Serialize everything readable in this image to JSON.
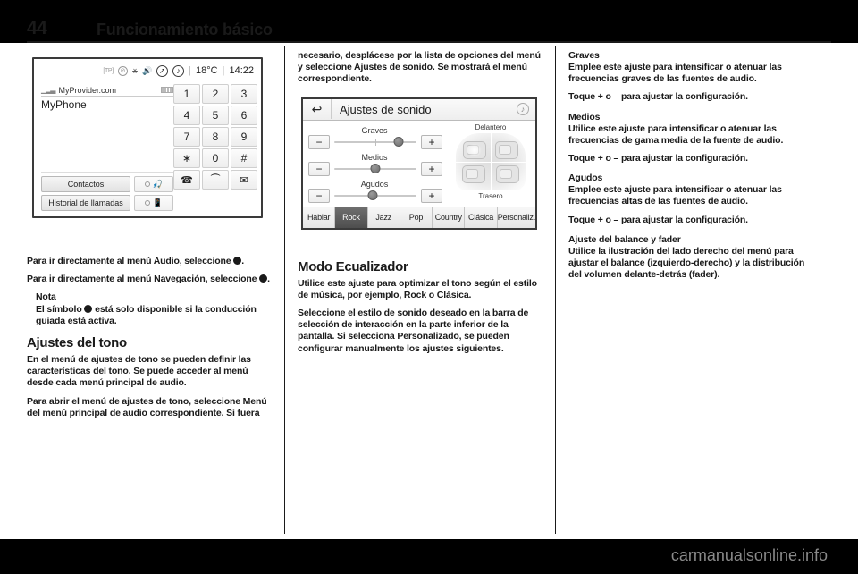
{
  "page": {
    "folio": "44",
    "chapter_title": "Funcionamiento básico",
    "footer_watermark": "carmanualsonline.info"
  },
  "figure_phone": {
    "status_bar": {
      "tp_label": "[TP]",
      "icons": [
        "tp-label",
        "no-entry-icon",
        "bluetooth-icon",
        "speaker-icon",
        "navigation-compass-icon",
        "audio-note-icon"
      ],
      "temperature": "18°C",
      "clock": "14:22"
    },
    "provider": "MyProvider.com",
    "device_name": "MyPhone",
    "buttons": {
      "contacts": "Contactos",
      "call_history": "Historial de llamadas"
    },
    "toggles": [
      "mute-microphone-icon",
      "phone-speaker-icon"
    ],
    "keypad": [
      "1",
      "2",
      "3",
      "4",
      "5",
      "6",
      "7",
      "8",
      "9",
      "∗",
      "0",
      "#"
    ],
    "keypad_star_secondary": "+",
    "action_keys": [
      "call-icon",
      "hang-up-icon",
      "voicemail-icon"
    ]
  },
  "figure_sound": {
    "back_icon": "back-arrow-icon",
    "title": "Ajustes de sonido",
    "corner_icon": "audio-note-icon",
    "sliders": [
      {
        "label": "Graves",
        "value_pct": 78,
        "minus": "−",
        "plus": "+"
      },
      {
        "label": "Medios",
        "value_pct": 50,
        "minus": "−",
        "plus": "+"
      },
      {
        "label": "Agudos",
        "value_pct": 47,
        "minus": "−",
        "plus": "+"
      }
    ],
    "balance_diagram": {
      "front_label": "Delantero",
      "rear_label": "Trasero"
    },
    "tabs": [
      {
        "label": "Hablar",
        "active": false
      },
      {
        "label": "Rock",
        "active": true
      },
      {
        "label": "Jazz",
        "active": false
      },
      {
        "label": "Pop",
        "active": false
      },
      {
        "label": "Country",
        "active": false
      },
      {
        "label": "Clásica",
        "active": false
      },
      {
        "label": "Personaliz.",
        "active": false
      }
    ]
  },
  "column_1": {
    "p1_a": "Para ir directamente al menú Audio,",
    "p1_b": "seleccione",
    "p1_c": ".",
    "p2_a": "Para ir directamente al menú",
    "p2_b": "Navegación, seleccione",
    "p2_c": ".",
    "note_title": "Nota",
    "note_a": "El símbolo",
    "note_b": "está solo disponible si la conducción guiada está activa.",
    "heading_tono": "Ajustes del tono",
    "p3": "En el menú de ajustes de tono se pueden definir las características del tono. Se puede acceder al menú desde cada menú principal de audio.",
    "p4": "Para abrir el menú de ajustes de tono, seleccione Menú del menú principal de audio correspondiente. Si fuera"
  },
  "column_2": {
    "p1": "necesario, desplácese por la lista de opciones del menú y seleccione Ajustes de sonido. Se mostrará el menú correspondiente.",
    "heading_eq": "Modo Ecualizador",
    "p2": "Utilice este ajuste para optimizar el tono según el estilo de música, por ejemplo, Rock o Clásica.",
    "p3": "Seleccione el estilo de sonido deseado en la barra de selección de interacción en la parte inferior de la pantalla. Si selecciona Personalizado, se pueden configurar manualmente los ajustes siguientes."
  },
  "column_3": {
    "heading_graves": "Graves",
    "graves_p1": "Emplee este ajuste para intensificar o atenuar las frecuencias graves de las fuentes de audio.",
    "graves_p2": "Toque + o – para ajustar la configuración.",
    "heading_medios": "Medios",
    "medios_p1": "Utilice este ajuste para intensificar o atenuar las frecuencias de gama media de la fuente de audio.",
    "medios_p2": "Toque + o – para ajustar la configuración.",
    "heading_agudos": "Agudos",
    "agudos_p1": "Emplee este ajuste para intensificar o atenuar las frecuencias altas de las fuentes de audio.",
    "agudos_p2": "Toque + o – para ajustar la configuración.",
    "heading_balance": "Ajuste del balance y fader",
    "balance_p1": "Utilice la ilustración del lado derecho del menú para ajustar el balance (izquierdo-derecho) y la distribución del volumen delante-detrás (fader)."
  }
}
